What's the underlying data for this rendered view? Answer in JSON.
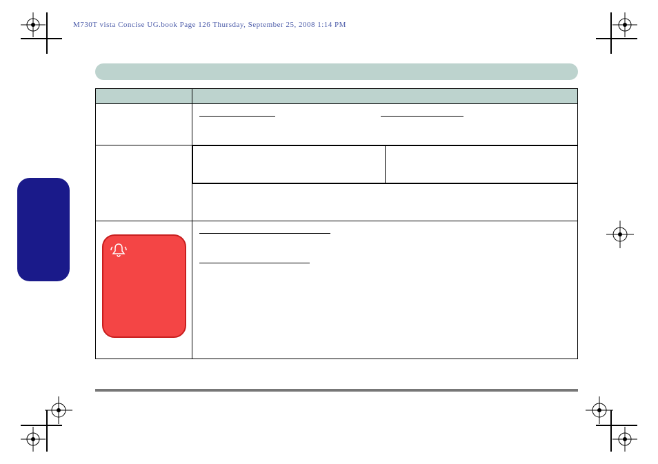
{
  "header": {
    "crop_text": "M730T vista Concise UG.book  Page 126  Thursday, September 25, 2008  1:14 PM"
  },
  "icons": {
    "bell": "🔔"
  }
}
